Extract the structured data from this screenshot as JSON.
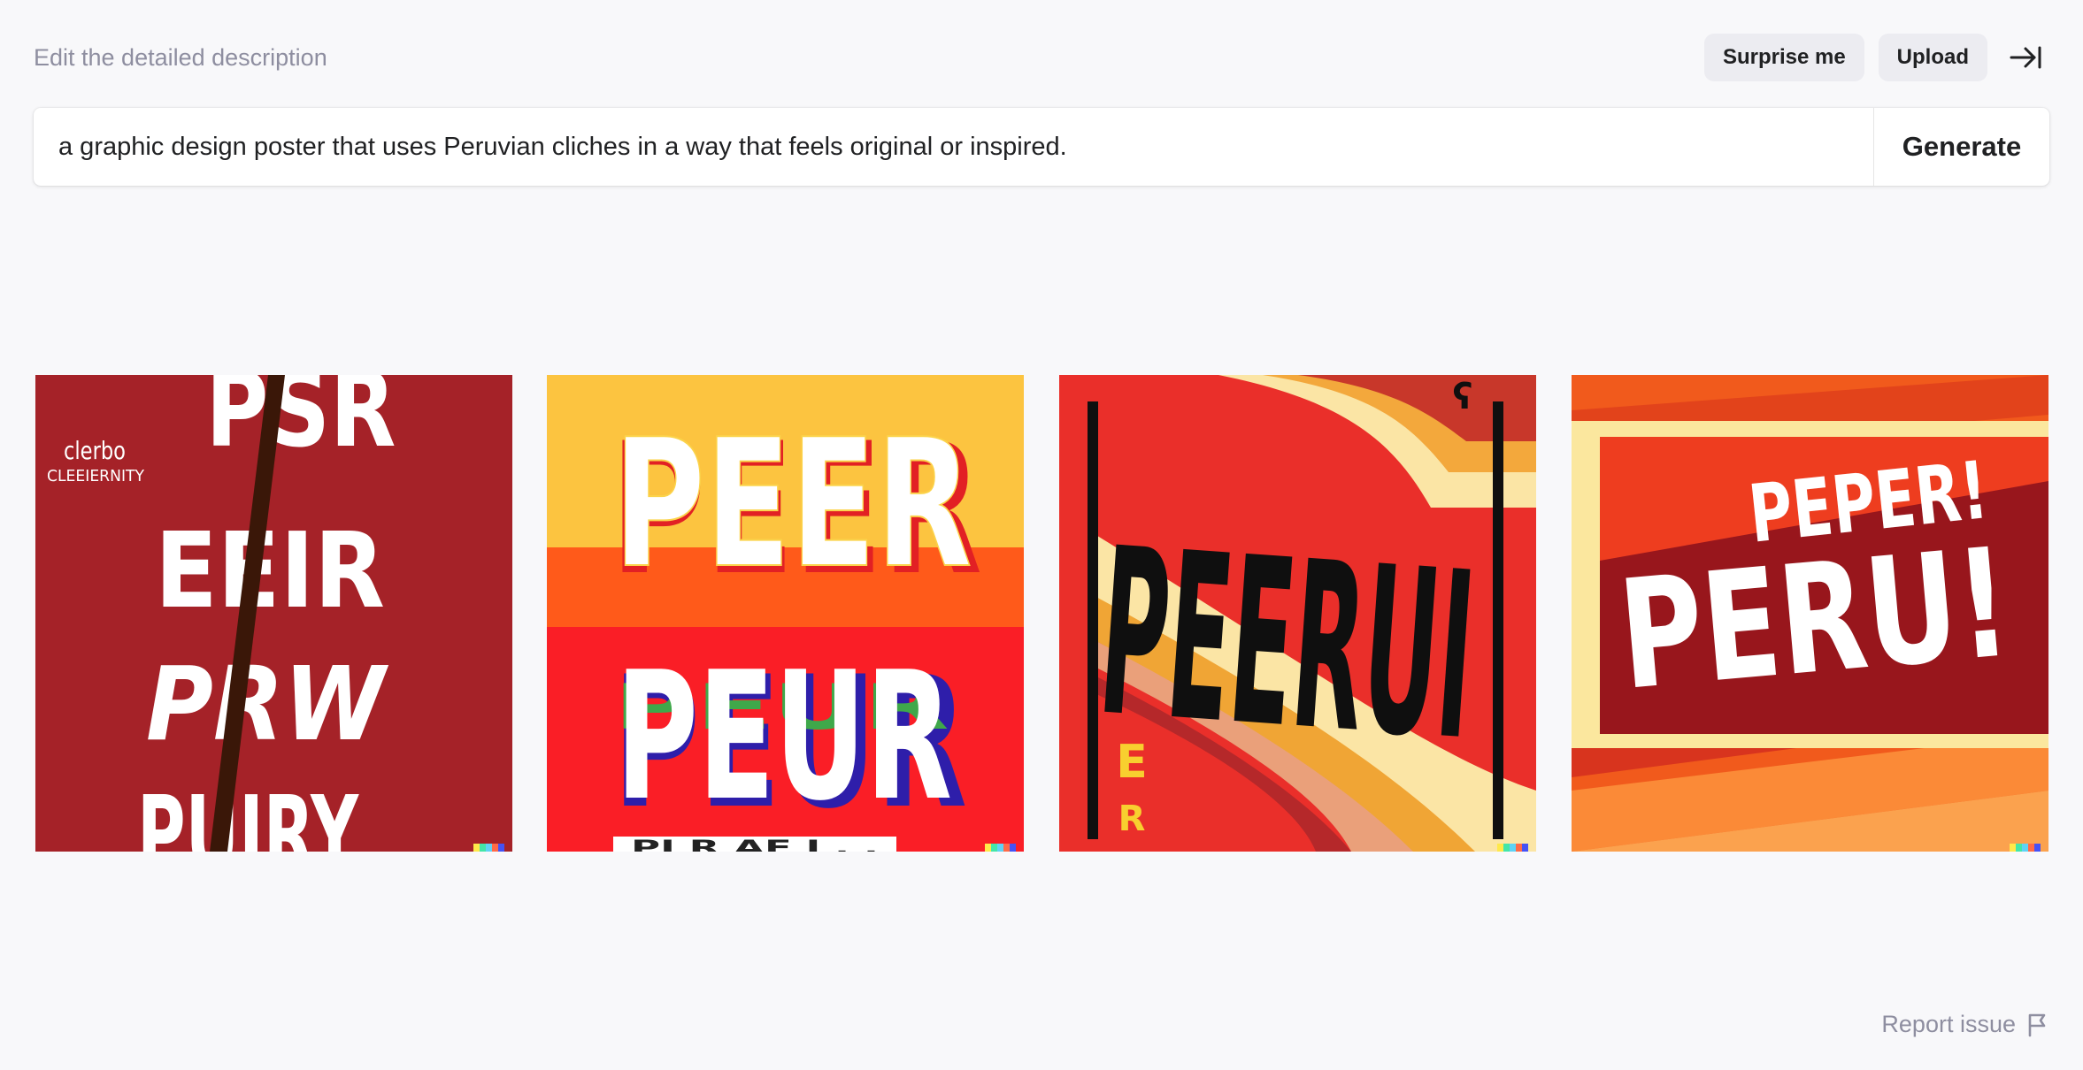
{
  "header": {
    "hint": "Edit the detailed description",
    "surprise_label": "Surprise me",
    "upload_label": "Upload"
  },
  "prompt": {
    "text": "a graphic design poster that uses Peruvian cliches in a way that feels original or inspired.",
    "generate_label": "Generate"
  },
  "images": [
    {
      "lines": [
        "PSR",
        "EEIR",
        "PRW",
        "PUIRY"
      ],
      "small_text": [
        "clerbo",
        "CLEEIERNITY"
      ]
    },
    {
      "lines": [
        "PEER",
        "PEUR"
      ],
      "small_text": [
        "PI R AF I . ."
      ]
    },
    {
      "lines": [
        "PEERUI"
      ],
      "small_text": [
        "E",
        "R"
      ]
    },
    {
      "lines": [
        "PEPER!",
        "PERU!"
      ]
    }
  ],
  "footer": {
    "report_label": "Report issue"
  },
  "colors": {
    "background": "#f8f8fa",
    "pill": "#ececf1",
    "muted_text": "#8e8ea0",
    "text": "#202123"
  }
}
